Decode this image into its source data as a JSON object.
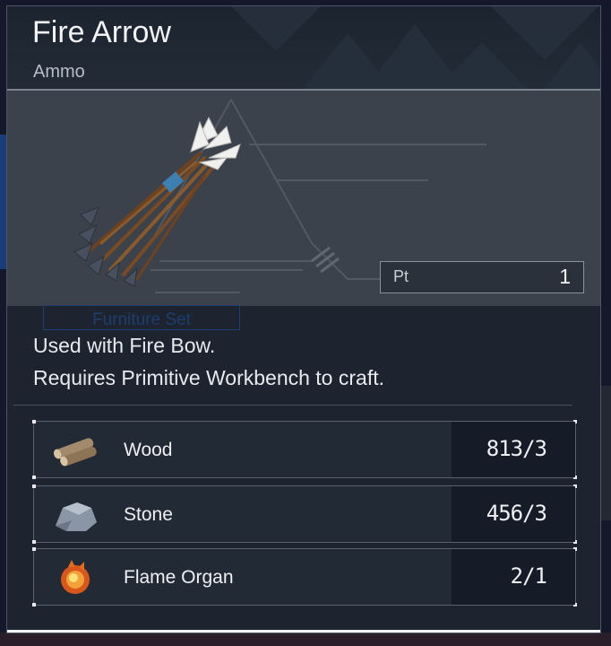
{
  "item": {
    "name": "Fire Arrow",
    "category": "Ammo",
    "image_icon": "arrow-bundle-icon",
    "pt_label": "Pt",
    "pt_value": "1"
  },
  "background": {
    "ghost_button_label": "Furniture Set"
  },
  "description": {
    "line1": "Used with Fire Bow.",
    "line2": "Requires Primitive Workbench to craft."
  },
  "requirements": [
    {
      "name": "Wood",
      "icon": "wood-icon",
      "quantity": "813/3"
    },
    {
      "name": "Stone",
      "icon": "stone-icon",
      "quantity": "456/3"
    },
    {
      "name": "Flame Organ",
      "icon": "flame-organ-icon",
      "quantity": "2/1"
    }
  ],
  "colors": {
    "panel_bg": "#1d2430",
    "preview_bg": "#3b424c",
    "qty_bg": "#161c27",
    "text": "#e8eaee"
  }
}
